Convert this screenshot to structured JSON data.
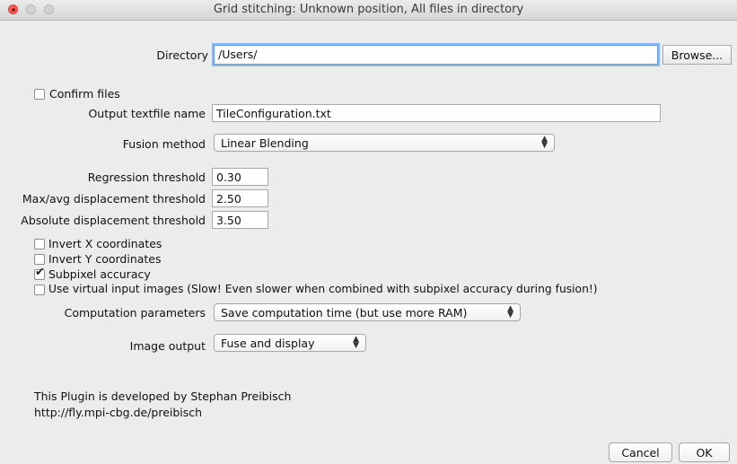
{
  "window": {
    "title": "Grid stitching: Unknown position, All files in directory"
  },
  "directory": {
    "label": "Directory",
    "value": "/Users/",
    "browse_label": "Browse..."
  },
  "confirm_files": {
    "label": "Confirm files",
    "checked": false
  },
  "output_textfile": {
    "label": "Output textfile name",
    "value": "TileConfiguration.txt"
  },
  "fusion_method": {
    "label": "Fusion method",
    "value": "Linear Blending"
  },
  "regression_threshold": {
    "label": "Regression threshold",
    "value": "0.30"
  },
  "max_avg_displacement": {
    "label": "Max/avg displacement threshold",
    "value": "2.50"
  },
  "absolute_displacement": {
    "label": "Absolute displacement threshold",
    "value": "3.50"
  },
  "checkboxes": [
    {
      "label": "Invert X coordinates",
      "checked": false
    },
    {
      "label": "Invert Y coordinates",
      "checked": false
    },
    {
      "label": "Subpixel accuracy",
      "checked": true
    },
    {
      "label": "Use virtual input images (Slow! Even slower when combined with subpixel accuracy during fusion!)",
      "checked": false
    }
  ],
  "computation_parameters": {
    "label": "Computation parameters",
    "value": "Save computation time (but use more RAM)"
  },
  "image_output": {
    "label": "Image output",
    "value": "Fuse and display"
  },
  "info": {
    "line1": "This Plugin is developed by Stephan Preibisch",
    "line2": "http://fly.mpi-cbg.de/preibisch"
  },
  "buttons": {
    "cancel": "Cancel",
    "ok": "OK"
  },
  "icons": {
    "popup_arrows": "updown-arrows-icon",
    "checkmark": "checkmark-icon"
  },
  "colors": {
    "close_button": "#fc5b57",
    "focus_ring": "#8db6ef",
    "window_bg": "#ececec"
  }
}
